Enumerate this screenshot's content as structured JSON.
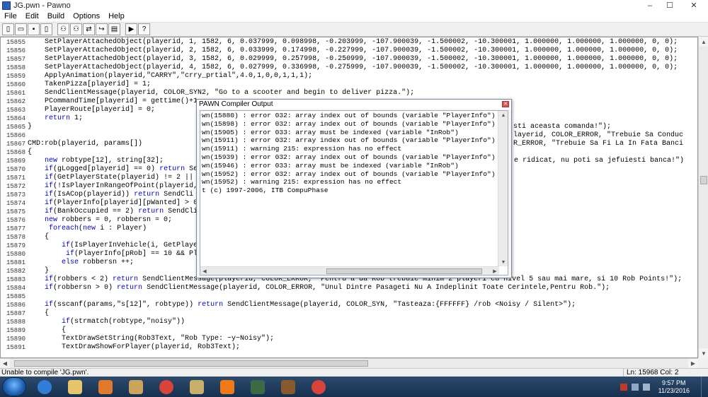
{
  "window": {
    "title": "JG.pwn - Pawno",
    "controls": [
      "–",
      "☐",
      "✕"
    ]
  },
  "menu": [
    "File",
    "Edit",
    "Build",
    "Options",
    "Help"
  ],
  "toolbar": {
    "buttons": [
      {
        "name": "new-file-button",
        "icon": "new-file-icon",
        "glyph": "▯"
      },
      {
        "name": "open-file-button",
        "icon": "open-folder-icon",
        "glyph": "▭"
      },
      {
        "name": "save-file-button",
        "icon": "save-icon",
        "glyph": "▪"
      },
      {
        "name": "close-file-button",
        "icon": "close-file-icon",
        "glyph": "▯"
      },
      {
        "name": "find-button",
        "icon": "binoculars-icon",
        "glyph": "⚇"
      },
      {
        "name": "find-next-button",
        "icon": "find-next-icon",
        "glyph": "⚇"
      },
      {
        "name": "replace-button",
        "icon": "replace-icon",
        "glyph": "⇄"
      },
      {
        "name": "goto-button",
        "icon": "goto-line-icon",
        "glyph": "↪"
      },
      {
        "name": "functions-button",
        "icon": "functions-icon",
        "glyph": "▤"
      },
      {
        "name": "compile-button",
        "icon": "run-icon",
        "glyph": "▶"
      },
      {
        "name": "help-button",
        "icon": "help-icon",
        "glyph": "?"
      }
    ]
  },
  "editor": {
    "lines": [
      {
        "n": "15855",
        "t": "    SetPlayerAttachedObject(playerid, 1, 1582, 6, 0.037999, 0.098998, -0.203999, -107.900039, -1.500002, -10.300001, 1.000000, 1.000000, 1.000000, 0, 0);"
      },
      {
        "n": "15856",
        "t": "    SetPlayerAttachedObject(playerid, 2, 1582, 6, 0.033999, 0.174998, -0.227999, -107.900039, -1.500002, -10.300001, 1.000000, 1.000000, 1.000000, 0, 0);"
      },
      {
        "n": "15857",
        "t": "    SetPlayerAttachedObject(playerid, 3, 1582, 6, 0.029999, 0.257998, -0.250999, -107.900039, -1.500002, -10.300001, 1.000000, 1.000000, 1.000000, 0, 0);"
      },
      {
        "n": "15858",
        "t": "    SetPlayerAttachedObject(playerid, 4, 1582, 6, 0.027999, 0.336998, -0.275999, -107.900039, -1.500002, -10.300001, 1.000000, 1.000000, 1.000000, 0, 0);"
      },
      {
        "n": "15859",
        "t": "    ApplyAnimation(playerid,\"CARRY\",\"crry_prtial\",4.0,1,0,0,1,1,1);"
      },
      {
        "n": "15860",
        "t": "    TakenPizza[playerid] = 1;"
      },
      {
        "n": "15861",
        "t": "    SendClientMessage(playerid, COLOR_SYN2, \"Go to a scooter and begin to deliver pizza.\");"
      },
      {
        "n": "15862",
        "t": "    PCommandTime[playerid] = gettime()+1"
      },
      {
        "n": "15863",
        "t": "    PlayerRoute[playerid] = 0;"
      },
      {
        "n": "15864",
        "t": "    return 1;"
      },
      {
        "n": "15865",
        "t": "}"
      },
      {
        "n": "15866",
        "t": ""
      },
      {
        "n": "15867",
        "t": "CMD:rob(playerid, params[])"
      },
      {
        "n": "15868",
        "t": "{"
      },
      {
        "n": "15869",
        "t": "    new robtype[12], string[32];"
      },
      {
        "n": "15870",
        "t": "    if(gLogged[playerid] == 0) return Se"
      },
      {
        "n": "15871",
        "t": "    if(GetPlayerState(playerid) != 2 ||"
      },
      {
        "n": "15872",
        "t": "    if(!IsPlayerInRangeOfPoint(playerid,"
      },
      {
        "n": "15873",
        "t": "    if(IsACop(playerid)) return SendCli"
      },
      {
        "n": "15874",
        "t": "    if(PlayerInfo[playerid][pWanted] > 0"
      },
      {
        "n": "15875",
        "t": "    if(BankOccupied == 2) return SendCli"
      },
      {
        "n": "15876",
        "t": "    new robbers = 0, robbersn = 0;"
      },
      {
        "n": "15877",
        "t": "     foreach(new i : Player)"
      },
      {
        "n": "15878",
        "t": "    {"
      },
      {
        "n": "15879",
        "t": "        if(IsPlayerInVehicle(i, GetPlaye"
      },
      {
        "n": "15880",
        "t": "         if(PlayerInfo[pRob] == 10 && Pl"
      },
      {
        "n": "15881",
        "t": "        else robbersn ++;"
      },
      {
        "n": "15882",
        "t": "    }"
      },
      {
        "n": "15883",
        "t": "    if(robbers < 2) return SendClientMessage(playerid, COLOR_ERROR, \"Pentru a da Rob trebuie minim 2 playeri cu nivel 5 sau mai mare, si 10 Rob Points!\");"
      },
      {
        "n": "15884",
        "t": "    if(robbersn > 0) return SendClientMessage(playerid, COLOR_ERROR, \"Unul Dintre Pasageti Nu A Indeplinit Toate Cerintele,Pentru Rob.\");"
      },
      {
        "n": "15885",
        "t": ""
      },
      {
        "n": "15886",
        "t": "    if(sscanf(params,\"s[12]\", robtype)) return SendClientMessage(playerid, COLOR_SYN, \"Tasteaza:{FFFFFF} /rob <Noisy / Silent>\");"
      },
      {
        "n": "15887",
        "t": "    {"
      },
      {
        "n": "15888",
        "t": "        if(strmatch(robtype,\"noisy\"))"
      },
      {
        "n": "15889",
        "t": "        {"
      },
      {
        "n": "15890",
        "t": "        TextDrawSetString(Rob3Text, \"Rob Type: ~y~Noisy\");"
      },
      {
        "n": "15891",
        "t": "        TextDrawShowForPlayer(playerid, Rob3Text);"
      }
    ],
    "overflow_fragments": [
      {
        "line": 10,
        "t": "sti aceasta comanda!\");"
      },
      {
        "line": 11,
        "t": "layerid, COLOR_ERROR, \"Trebuie Sa Conduc"
      },
      {
        "line": 12,
        "t": "R_ERROR, \"Trebuie Sa Fi La In Fata Banci"
      },
      {
        "line": 14,
        "t": "e ridicat, nu poti sa jefuiesti banca!\")"
      }
    ]
  },
  "compiler_dialog": {
    "title": "PAWN Compiler Output",
    "lines": [
      "wn(15880) : error 032: array index out of bounds (variable \"PlayerInfo\")",
      "wn(15898) : error 032: array index out of bounds (variable \"PlayerInfo\")",
      "wn(15905) : error 033: array must be indexed (variable \"InRob\")",
      "wn(15911) : error 032: array index out of bounds (variable \"PlayerInfo\")",
      "wn(15911) : warning 215: expression has no effect",
      "wn(15939) : error 032: array index out of bounds (variable \"PlayerInfo\")",
      "wn(15946) : error 033: array must be indexed (variable \"InRob\")",
      "wn(15952) : error 032: array index out of bounds (variable \"PlayerInfo\")",
      "wn(15952) : warning 215: expression has no effect",
      "t (c) 1997-2006, ITB CompuPhase"
    ]
  },
  "statusbar": {
    "message": "Unable to compile 'JG.pwn'.",
    "position": "Ln: 15968  Col: 2"
  },
  "taskbar": {
    "apps": [
      {
        "name": "ie-app",
        "icon": "internet-explorer-icon",
        "color": "#2f7fd6"
      },
      {
        "name": "explorer-app",
        "icon": "folder-icon",
        "color": "#e8c46a"
      },
      {
        "name": "media-player-app",
        "icon": "media-player-icon",
        "color": "#e07a2a"
      },
      {
        "name": "paint-app",
        "icon": "paint-palette-icon",
        "color": "#c9a45a"
      },
      {
        "name": "chrome-app",
        "icon": "chrome-icon",
        "color": "#d9443a"
      },
      {
        "name": "chess-app",
        "icon": "chess-pawn-icon",
        "color": "#c8b06a"
      },
      {
        "name": "xampp-app",
        "icon": "xampp-icon",
        "color": "#f07a18"
      },
      {
        "name": "pawno-app",
        "icon": "pawno-window-icon",
        "color": "#3b6a44"
      },
      {
        "name": "game-app",
        "icon": "game-character-icon",
        "color": "#8a5a2e"
      },
      {
        "name": "chrome-app-2",
        "icon": "chrome-icon",
        "color": "#d9443a"
      }
    ],
    "clock_time": "9:57 PM",
    "clock_date": "11/23/2016"
  },
  "colors": {
    "keyword": "#0000cc",
    "taskbar": "#1e3a5c"
  }
}
